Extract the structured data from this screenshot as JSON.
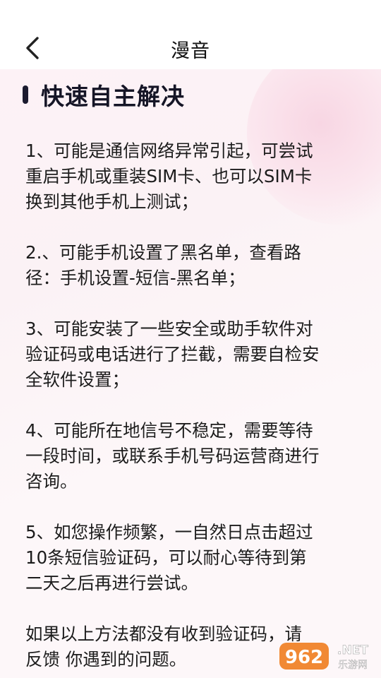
{
  "header": {
    "title": "漫音",
    "back_icon": "chevron-left-icon"
  },
  "section": {
    "title": "快速自主解决"
  },
  "paragraphs": [
    "1、可能是通信网络异常引起，可尝试\n重启手机或重装SIM卡、也可以SIM卡\n换到其他手机上测试；",
    "2.、可能手机设置了黑名单，查看路\n径：手机设置-短信-黑名单；",
    "3、可能安装了一些安全或助手软件对\n验证码或电话进行了拦截，需要自检安\n全软件设置；",
    "4、可能所在地信号不稳定，需要等待\n一段时间，或联系手机号码运营商进行\n咨询。",
    "5、如您操作频繁，一自然日点击超过\n10条短信验证码，可以耐心等待到第\n二天之后再进行尝试。",
    "如果以上方法都没有收到验证码，请\n反馈 你遇到的问题。"
  ],
  "watermark": {
    "number": "962",
    "suffix": ".NET",
    "sub": "乐游网"
  },
  "colors": {
    "accent_dark": "#1b1b2f",
    "background_tint": "#fdf2f6",
    "watermark_orange": "#f07c1e"
  }
}
